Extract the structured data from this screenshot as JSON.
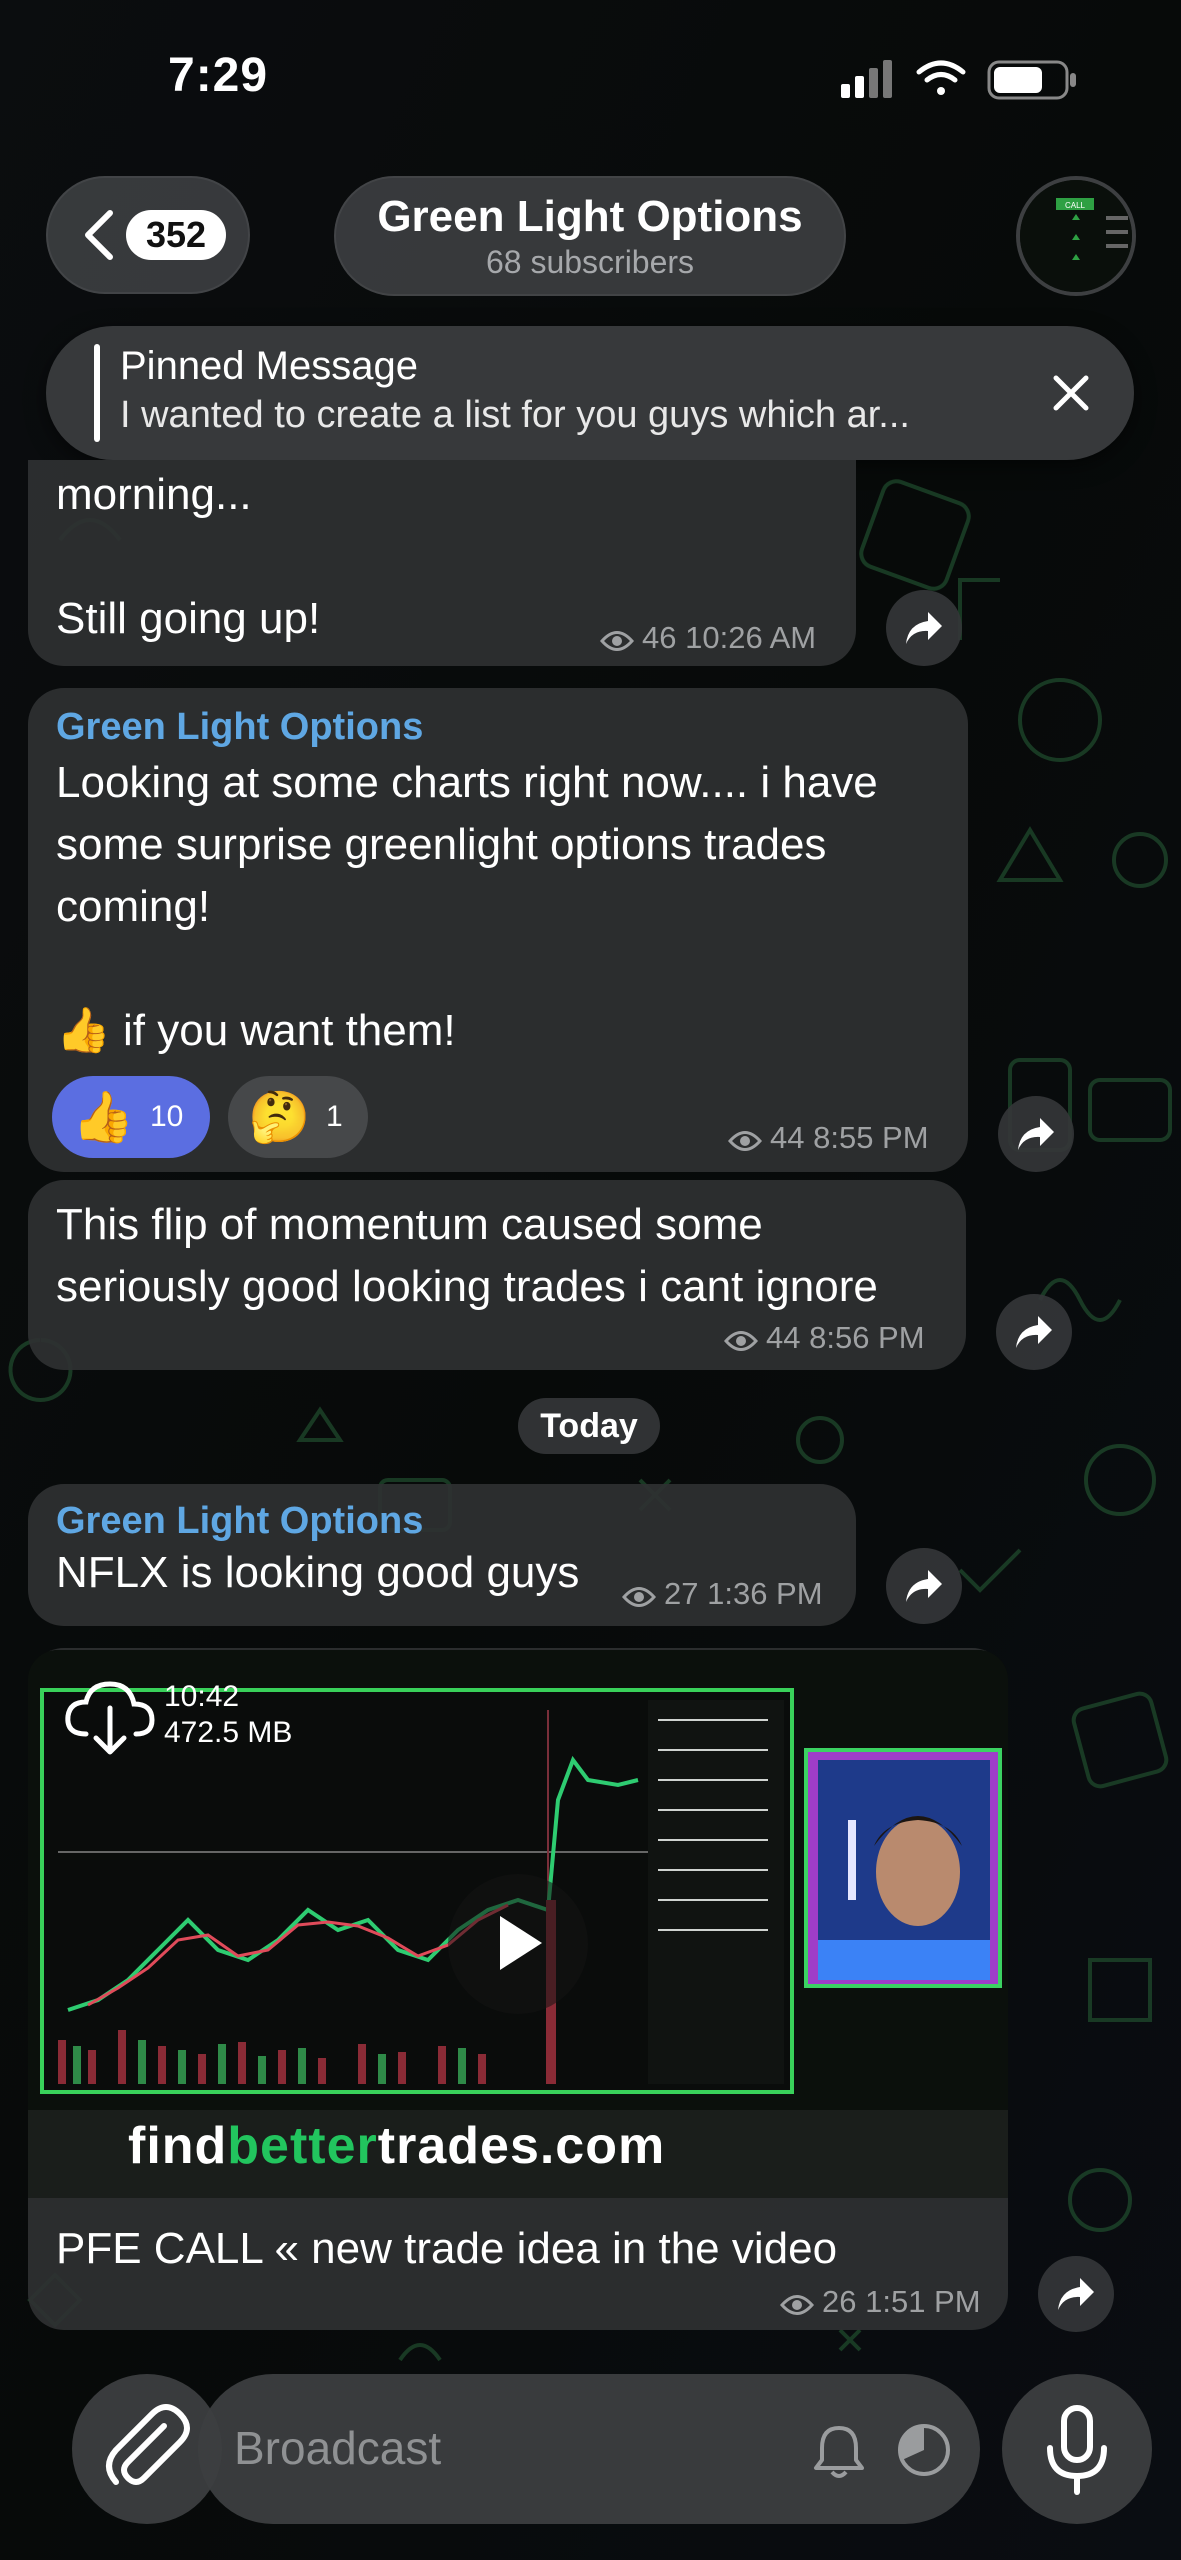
{
  "status": {
    "time": "7:29"
  },
  "header": {
    "back_count": "352",
    "title": "Green Light Options",
    "subtitle": "68 subscribers"
  },
  "pinned": {
    "title": "Pinned Message",
    "text": "I wanted to create a list for you guys which ar..."
  },
  "messages": [
    {
      "text": "morning...\n\nStill going up!",
      "views": "46",
      "time": "10:26 AM"
    },
    {
      "sender": "Green Light Options",
      "text": "Looking at some charts right now.... i have\nsome surprise greenlight options trades\ncoming!\n\n👍 if you want them!",
      "reactions": [
        {
          "emoji": "👍",
          "count": "10",
          "active": true
        },
        {
          "emoji": "🤔",
          "count": "1",
          "active": false
        }
      ],
      "views": "44",
      "time": "8:55 PM"
    },
    {
      "text": "This flip of momentum caused some\nseriously good looking trades i cant ignore",
      "views": "44",
      "time": "8:56 PM"
    },
    {
      "sender": "Green Light Options",
      "text": "NFLX is looking good guys",
      "views": "27",
      "time": "1:36 PM"
    },
    {
      "video": {
        "duration": "10:42",
        "size": "472.5 MB",
        "watermark_a": "find",
        "watermark_b": "better",
        "watermark_c": "trades.com"
      },
      "text": "PFE CALL « new trade idea in the video",
      "views": "26",
      "time": "1:51 PM"
    }
  ],
  "date_separator": "Today",
  "composer": {
    "placeholder": "Broadcast"
  },
  "colors": {
    "accent_blue": "#5fa7e3",
    "reaction_active": "#5b6ee1",
    "bubble": "#2e3032",
    "brand_green": "#22c55e"
  },
  "icons": [
    "back-chevron-icon",
    "eye-icon",
    "share-icon",
    "close-icon",
    "download-icon",
    "play-icon",
    "paperclip-icon",
    "bell-icon",
    "timer-icon",
    "microphone-icon"
  ]
}
